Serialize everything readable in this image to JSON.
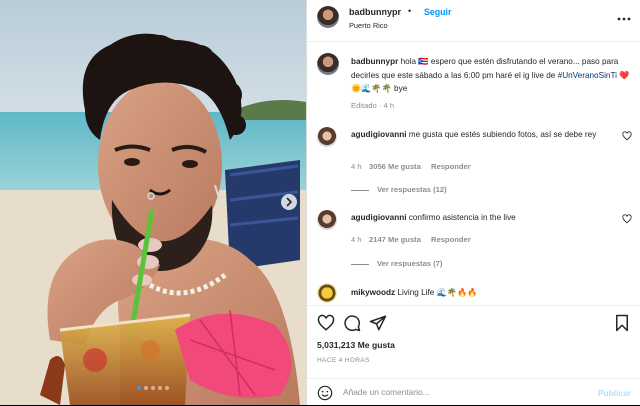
{
  "post_header": {
    "username": "badbunnypr",
    "follow_label": "Seguir",
    "separator": "•",
    "location": "Puerto Rico",
    "more_icon": "more-icon"
  },
  "caption": {
    "username": "badbunnypr",
    "text_before_hashtag": "hola 🇵🇷 espero que estén disfrutando el verano... paso para decirles que este sábado a las 6:00 pm haré el ig live de ",
    "hashtag": "#UnVeranoSinTi",
    "text_after_hashtag": " ❤️🌞🌊🌴🌴 bye",
    "edited_label": "Editado · 4 h"
  },
  "comments": [
    {
      "username": "agudigiovanni",
      "text": "me gusta que estés subiendo fotos, así se debe rey",
      "time": "4 h",
      "likes": "3056 Me gusta",
      "reply_label": "Responder",
      "view_replies": "Ver respuestas (12)"
    },
    {
      "username": "agudigiovanni",
      "text": "confirmo asistencia in the live",
      "time": "4 h",
      "likes": "2147 Me gusta",
      "reply_label": "Responder",
      "view_replies": "Ver respuestas (7)"
    },
    {
      "username": "mikywoodz",
      "text": "Living Life 🌊🌴🔥🔥"
    }
  ],
  "actions": {
    "like_icon": "heart-outline-icon",
    "comment_icon": "comment-icon",
    "share_icon": "send-icon",
    "save_icon": "bookmark-icon"
  },
  "post_stats": {
    "likes": "5,031,213 Me gusta",
    "time": "HACE 4 HORAS"
  },
  "comment_box": {
    "placeholder": "Añade un comentario...",
    "publish_label": "Publicar",
    "emoji_icon": "smiley-icon"
  },
  "carousel": {
    "current_index": 1,
    "count": 5,
    "next_icon": "chevron-right-icon"
  },
  "colors": {
    "link_blue": "#0095f6",
    "hashtag_blue": "#00376b",
    "muted": "#8e8e8e",
    "publish_disabled": "#b2dffc"
  }
}
